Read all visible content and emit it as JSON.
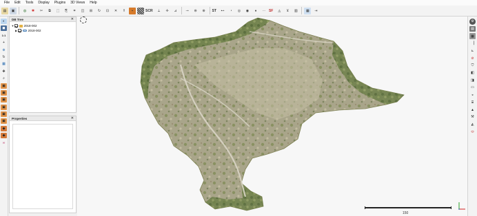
{
  "menu": [
    "File",
    "Edit",
    "Tools",
    "Display",
    "Plugins",
    "3D Views",
    "Help"
  ],
  "toolbar": {
    "icons": [
      "open-icon",
      "save-icon",
      "globe-icon",
      "star-icon",
      "cut-icon",
      "merge-icon",
      "subsample-icon",
      "clone-icon",
      "sample-icon",
      "segment-icon",
      "translate-icon",
      "rotate-icon",
      "crop-icon",
      "delete-icon",
      "normals-icon",
      "color-icon",
      "scale-icon",
      "sf-icon",
      "gradient-icon",
      "distance-icon",
      "cloud-mesh-icon",
      "pick-icon",
      "plane-icon",
      "filter-icon",
      "measure-icon",
      "align-icon",
      "register-icon",
      "zoom-icon",
      "label-icon",
      "point-list-icon"
    ],
    "scale_label": "SCR",
    "st_label": "ST",
    "sf_label": "SF"
  },
  "left_toolbar": [
    "view-3d-icon",
    "camera-icon",
    "perspective-icon",
    "crosshair-icon",
    "pivot-icon",
    "rotate-icon",
    "zoom-fit-icon",
    "move-icon",
    "light-icon",
    "front-view-icon",
    "top-view-icon",
    "left-view-icon",
    "back-view-icon",
    "iso-view-icon",
    "iso2-view-icon",
    "iso3-view-icon",
    "shader-icon",
    "link-icon"
  ],
  "left_toolbar_labels": {
    "icon3": "1:1"
  },
  "db_tree": {
    "title": "DB Tree",
    "root": "2018-002",
    "child": "2018-002"
  },
  "properties": {
    "title": "Properties"
  },
  "viewport": {
    "scale_value": "150"
  },
  "right_toolbar": [
    "settings-icon",
    "layers-icon",
    "ruler-icon",
    "measure-icon",
    "compass-icon",
    "no-entry-icon",
    "shield-icon",
    "cube-icon",
    "box-icon",
    "layer-icon",
    "shapes-icon",
    "cylinder-icon",
    "cone-icon",
    "tool-icon",
    "cone2-icon",
    "ellipse-icon"
  ],
  "colors": {
    "accent": "#2f6fb0",
    "terrain": "#9c9a7c"
  }
}
